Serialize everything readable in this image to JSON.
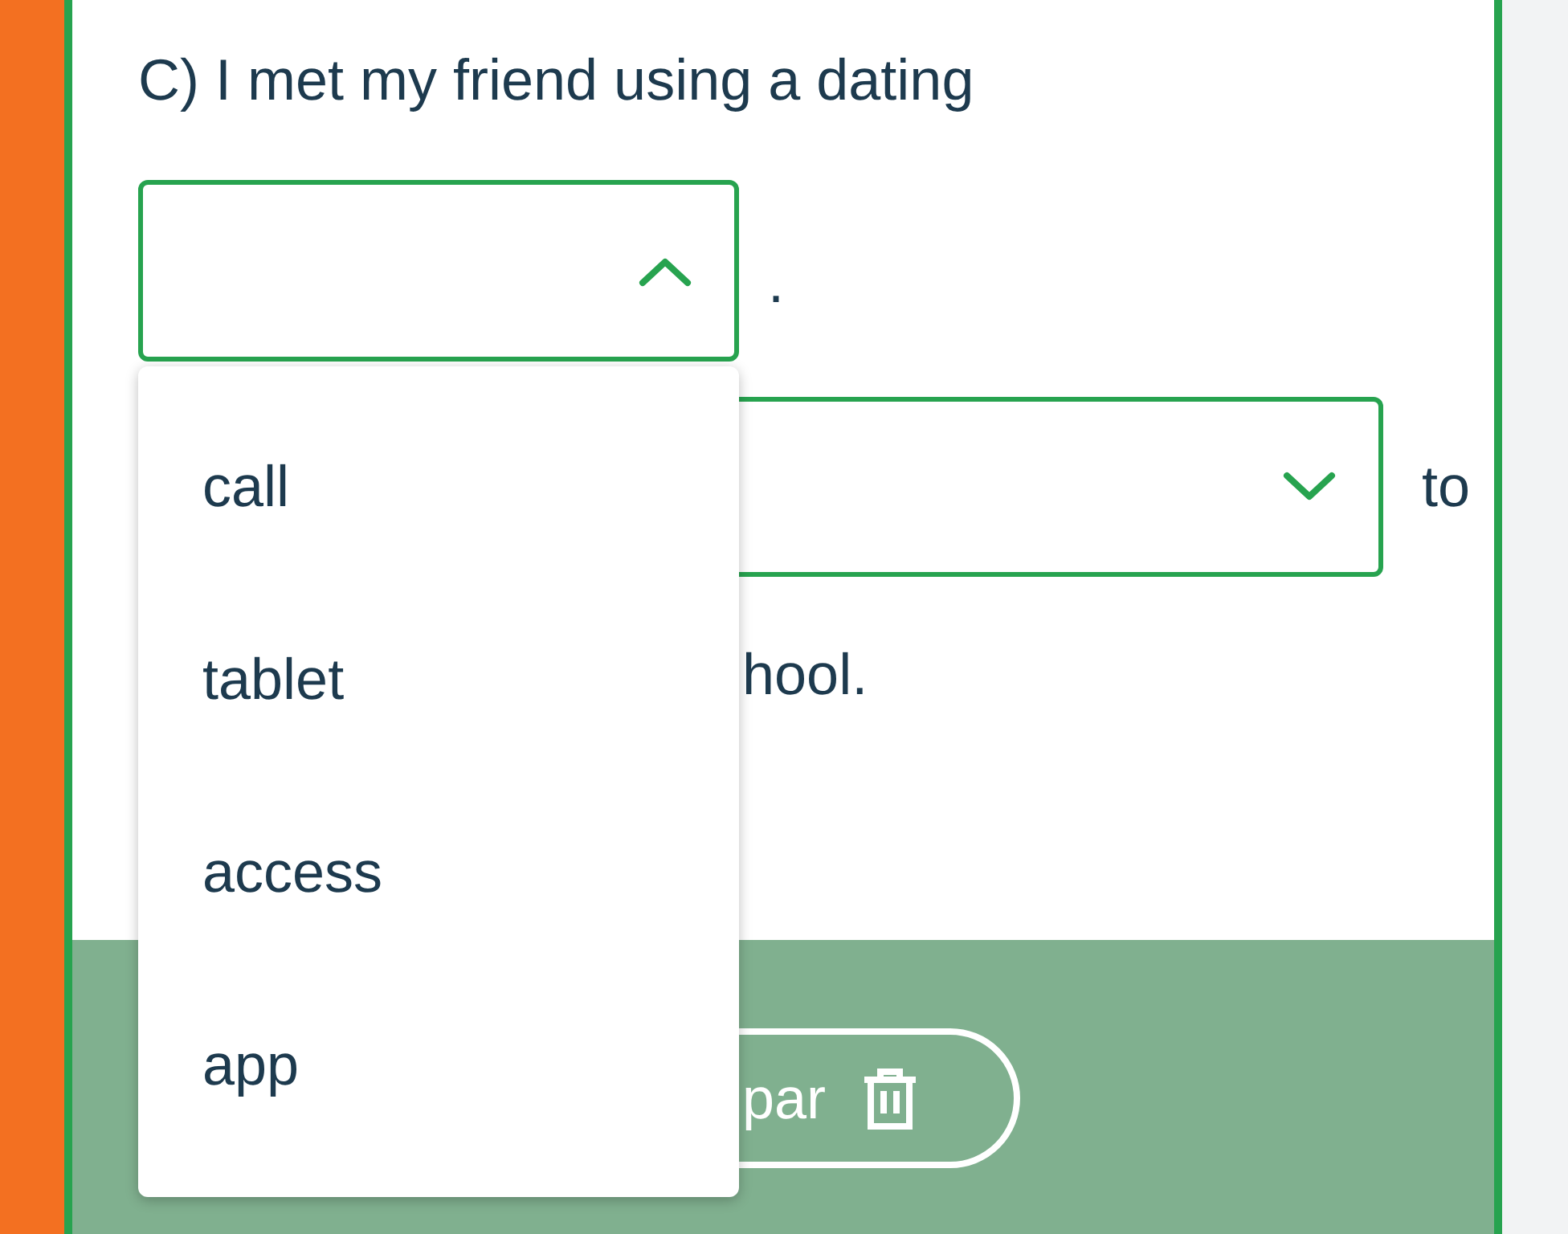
{
  "question": {
    "prompt": "C) I met my friend using a dating",
    "blanks": [
      {
        "expanded": true,
        "after": "."
      },
      {
        "expanded": false,
        "after": "to"
      }
    ],
    "trailing": "hool."
  },
  "dropdown": {
    "options": [
      {
        "label": "call",
        "selected": false
      },
      {
        "label": "tablet",
        "selected": false
      },
      {
        "label": "access",
        "selected": false
      },
      {
        "label": "app",
        "selected": false
      }
    ]
  },
  "footer": {
    "button": "par"
  }
}
